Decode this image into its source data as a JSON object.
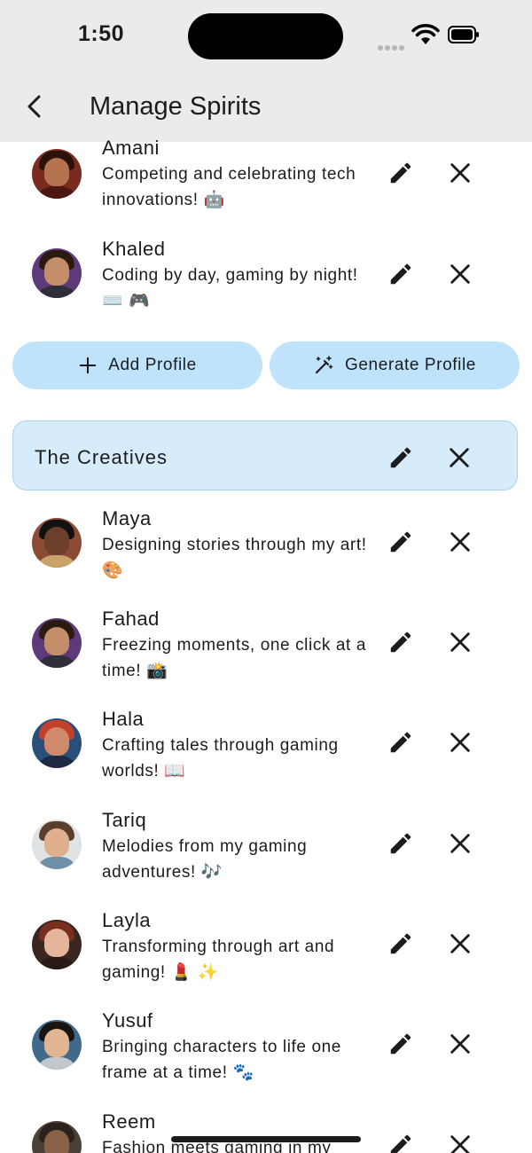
{
  "status_bar": {
    "time": "1:50"
  },
  "header": {
    "title": "Manage Spirits"
  },
  "top_profiles": [
    {
      "name": "Amani",
      "bio": "Competing and celebrating tech innovations! 🤖"
    },
    {
      "name": "Khaled",
      "bio": "Coding by day, gaming by night! ⌨️ 🎮"
    }
  ],
  "actions": {
    "add_label": "Add Profile",
    "generate_label": "Generate Profile"
  },
  "group": {
    "name": "The Creatives",
    "profiles": [
      {
        "name": "Maya",
        "bio": "Designing stories through my art! 🎨"
      },
      {
        "name": "Fahad",
        "bio": "Freezing moments, one click at a time! 📸"
      },
      {
        "name": "Hala",
        "bio": "Crafting tales through gaming worlds! 📖"
      },
      {
        "name": "Tariq",
        "bio": "Melodies from my gaming adventures! 🎶"
      },
      {
        "name": "Layla",
        "bio": "Transforming through art and gaming! 💄 ✨"
      },
      {
        "name": "Yusuf",
        "bio": "Bringing characters to life one frame at a time! 🐾"
      },
      {
        "name": "Reem",
        "bio": "Fashion meets gaming in my"
      }
    ]
  },
  "icons": {
    "back": "chevron-left-icon",
    "edit": "pencil-icon",
    "delete": "close-icon",
    "add": "plus-icon",
    "generate": "magic-wand-icon"
  },
  "colors": {
    "accent": "#bfe3fb",
    "group_bg": "#d7ecfb",
    "bar_bg": "#ebebeb"
  }
}
